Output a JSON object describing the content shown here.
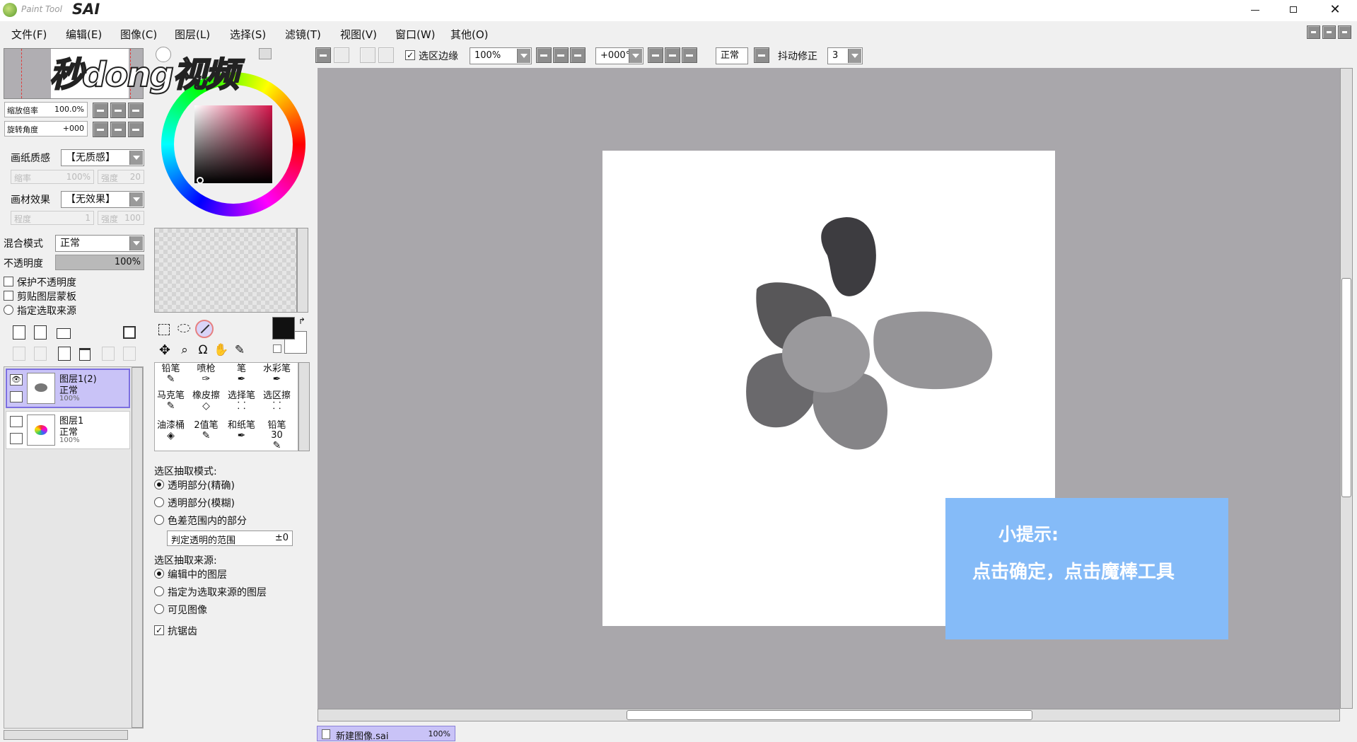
{
  "app": {
    "logo_text": "Paint Tool",
    "logo_brand": "SAI"
  },
  "menu": [
    "文件(F)",
    "编辑(E)",
    "图像(C)",
    "图层(L)",
    "选择(S)",
    "滤镜(T)",
    "视图(V)",
    "窗口(W)",
    "其他(O)"
  ],
  "watermark": "秒dong视频",
  "toolbar": {
    "selection_edge_label": "选区边缘",
    "zoom_value": "100%",
    "rotation_value": "+000°",
    "blend_value": "正常",
    "stabilizer_label": "抖动修正",
    "stabilizer_value": "3"
  },
  "navigator": {
    "zoom_label": "缩放倍率",
    "zoom_value": "100.0%",
    "rotate_label": "旋转角度",
    "rotate_value": "+000"
  },
  "paper": {
    "texture_label": "画纸质感",
    "texture_value": "【无质感】",
    "scale_label": "缩率",
    "scale_value": "100%",
    "strength_label": "强度",
    "strength_value": "20",
    "effect_label": "画材效果",
    "effect_value": "【无效果】",
    "degree_label": "程度",
    "degree_value": "1",
    "effect_strength_label": "强度",
    "effect_strength_value": "100"
  },
  "layer_props": {
    "blend_label": "混合模式",
    "blend_value": "正常",
    "opacity_label": "不透明度",
    "opacity_value": "100%",
    "opacity_fraction": 1.0,
    "protect_opacity": "保护不透明度",
    "clip_mask": "剪贴图层蒙板",
    "selection_source": "指定选取来源"
  },
  "layers": [
    {
      "name": "图层1(2)",
      "mode": "正常",
      "opacity": "100%",
      "selected": true
    },
    {
      "name": "图层1",
      "mode": "正常",
      "opacity": "100%",
      "selected": false
    }
  ],
  "brushes": [
    [
      "铅笔",
      "喷枪",
      "笔",
      "水彩笔"
    ],
    [
      "马克笔",
      "橡皮擦",
      "选择笔",
      "选区擦"
    ],
    [
      "油漆桶",
      "2值笔",
      "和纸笔",
      "铅笔30"
    ]
  ],
  "magic_wand": {
    "mode_title": "选区抽取模式:",
    "mode_options": [
      "透明部分(精确)",
      "透明部分(模糊)",
      "色差范围内的部分"
    ],
    "mode_selected": 0,
    "range_label": "判定透明的范围",
    "range_value": "±0",
    "source_title": "选区抽取来源:",
    "source_options": [
      "编辑中的图层",
      "指定为选取来源的图层",
      "可见图像"
    ],
    "source_selected": 0,
    "antialias_label": "抗锯齿"
  },
  "tip": {
    "title": "小提示:",
    "body": "点击确定，点击魔棒工具"
  },
  "document_tab": {
    "name": "新建图像.sai",
    "zoom": "100%"
  },
  "colors": {
    "canvas_bg": "#a9a7ab",
    "tip_bg": "#85bbf8",
    "layer_selected": "#c9c3f7",
    "foreground": "#000000",
    "background": "#ffffff"
  }
}
